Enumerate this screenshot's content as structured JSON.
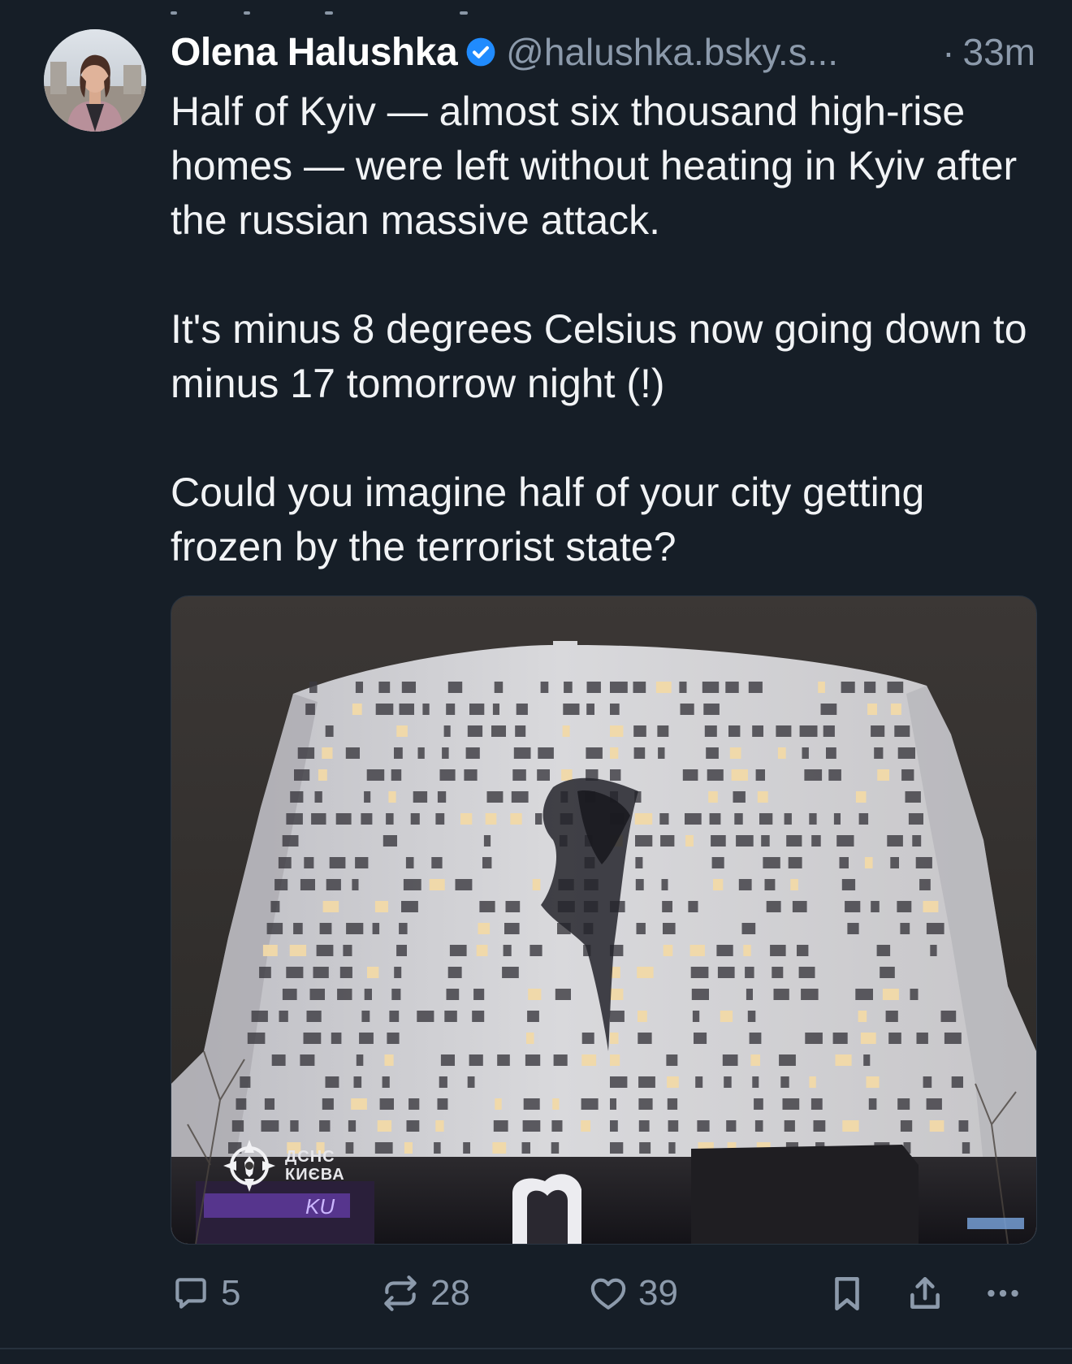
{
  "post": {
    "author": {
      "name": "Olena Halushka",
      "handle": "@halushka.bsky.s...",
      "verified": true,
      "avatar": "avatar"
    },
    "separator": "·",
    "timestamp": "33m",
    "paragraphs": [
      "Half of Kyiv — almost six thousand high-rise homes — were left without heating in Kyiv after the russian massive attack.",
      "It's minus 8 degrees Celsius now going down to minus 17 tomorrow night (!)",
      "Could you imagine half of your city getting frozen by the terrorist state?"
    ],
    "image": {
      "watermark_line1": "ДСНС",
      "watermark_line2": "КИЄВА",
      "storefront_sign": "KU"
    },
    "actions": {
      "replies": "5",
      "reposts": "28",
      "likes": "39"
    },
    "icons": {
      "reply": "reply-icon",
      "repost": "repost-icon",
      "like": "heart-icon",
      "bookmark": "bookmark-icon",
      "share": "share-icon",
      "more": "more-icon",
      "verified": "verified-badge-icon"
    },
    "colors": {
      "background": "#161e27",
      "text": "#f1f3f5",
      "muted": "#8c9aab",
      "verified": "#208bfe"
    }
  }
}
